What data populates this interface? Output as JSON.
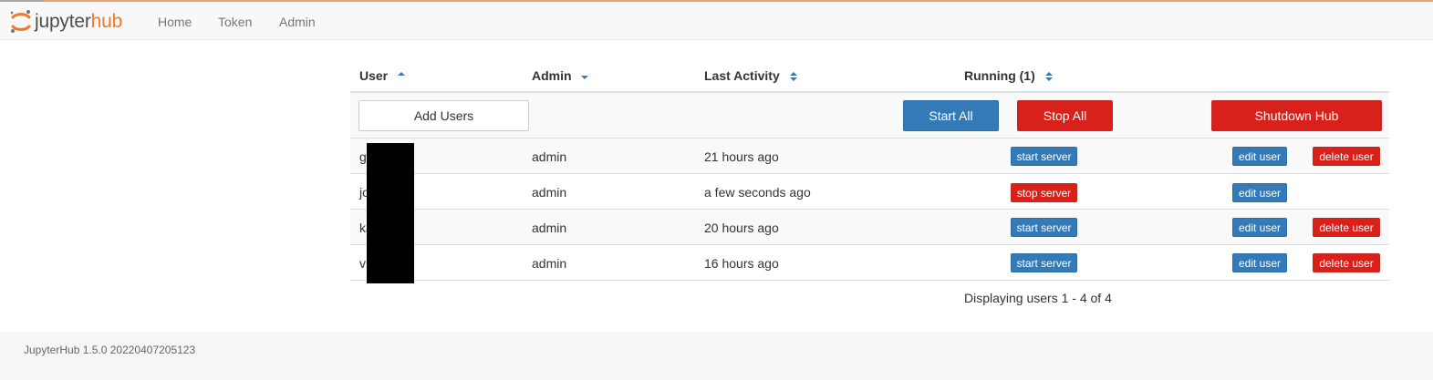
{
  "nav": {
    "logo_text_main": "jupyter",
    "logo_text_accent": "hub",
    "links": [
      "Home",
      "Token",
      "Admin"
    ]
  },
  "table": {
    "headers": {
      "user": "User",
      "admin": "Admin",
      "last_activity": "Last Activity",
      "running": "Running (1)"
    },
    "actions": {
      "add_users": "Add Users",
      "start_all": "Start All",
      "stop_all": "Stop All",
      "shutdown_hub": "Shutdown Hub"
    },
    "rows": [
      {
        "name": "g",
        "admin": "admin",
        "last_activity": "21 hours ago",
        "server_button": "start server",
        "server_running": false,
        "edit": "edit user",
        "delete": "delete user"
      },
      {
        "name": "jo",
        "admin": "admin",
        "last_activity": "a few seconds ago",
        "server_button": "stop server",
        "server_running": true,
        "edit": "edit user",
        "delete": ""
      },
      {
        "name": "ka",
        "admin": "admin",
        "last_activity": "20 hours ago",
        "server_button": "start server",
        "server_running": false,
        "edit": "edit user",
        "delete": "delete user"
      },
      {
        "name": "vi",
        "admin": "admin",
        "last_activity": "16 hours ago",
        "server_button": "start server",
        "server_running": false,
        "edit": "edit user",
        "delete": "delete user"
      }
    ],
    "paging_text": "Displaying users 1 - 4 of 4"
  },
  "footer": {
    "version_text": "JupyterHub 1.5.0 20220407205123"
  },
  "colors": {
    "primary": "#337ab7",
    "danger": "#d9211c",
    "brand_orange": "#f37726",
    "sort_arrow": "#337ab7"
  }
}
